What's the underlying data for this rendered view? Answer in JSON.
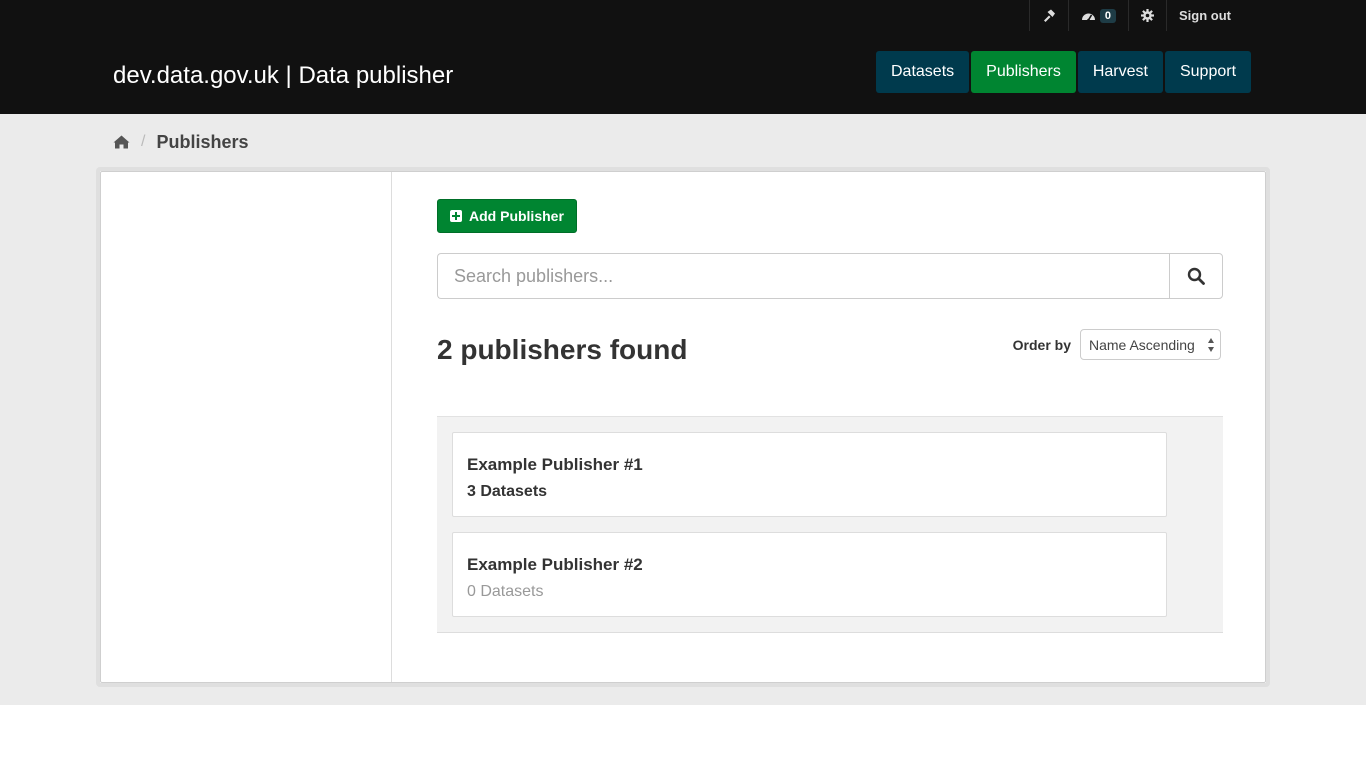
{
  "header": {
    "site_title": "dev.data.gov.uk | Data publisher",
    "account": {
      "tools_icon": "hammer-icon",
      "dashboard_icon": "dashboard-icon",
      "notification_count": "0",
      "settings_icon": "gear-icon",
      "sign_out_label": "Sign out"
    },
    "nav": [
      {
        "label": "Datasets",
        "active": false
      },
      {
        "label": "Publishers",
        "active": true
      },
      {
        "label": "Harvest",
        "active": false
      },
      {
        "label": "Support",
        "active": false
      }
    ]
  },
  "breadcrumb": {
    "home_icon": "home-icon",
    "current": "Publishers"
  },
  "main": {
    "add_button_label": "Add Publisher",
    "search": {
      "placeholder": "Search publishers...",
      "value": ""
    },
    "results_title": "2 publishers found",
    "order_by": {
      "label": "Order by",
      "selected": "Name Ascending"
    },
    "publishers": [
      {
        "name": "Example Publisher #1",
        "datasets": "3 Datasets"
      },
      {
        "name": "Example Publisher #2",
        "datasets": "0 Datasets"
      }
    ]
  },
  "colors": {
    "masthead": "#111111",
    "nav_default": "#003a4d",
    "nav_active": "#008531",
    "add_button": "#008531",
    "page_background": "#ebebeb"
  }
}
